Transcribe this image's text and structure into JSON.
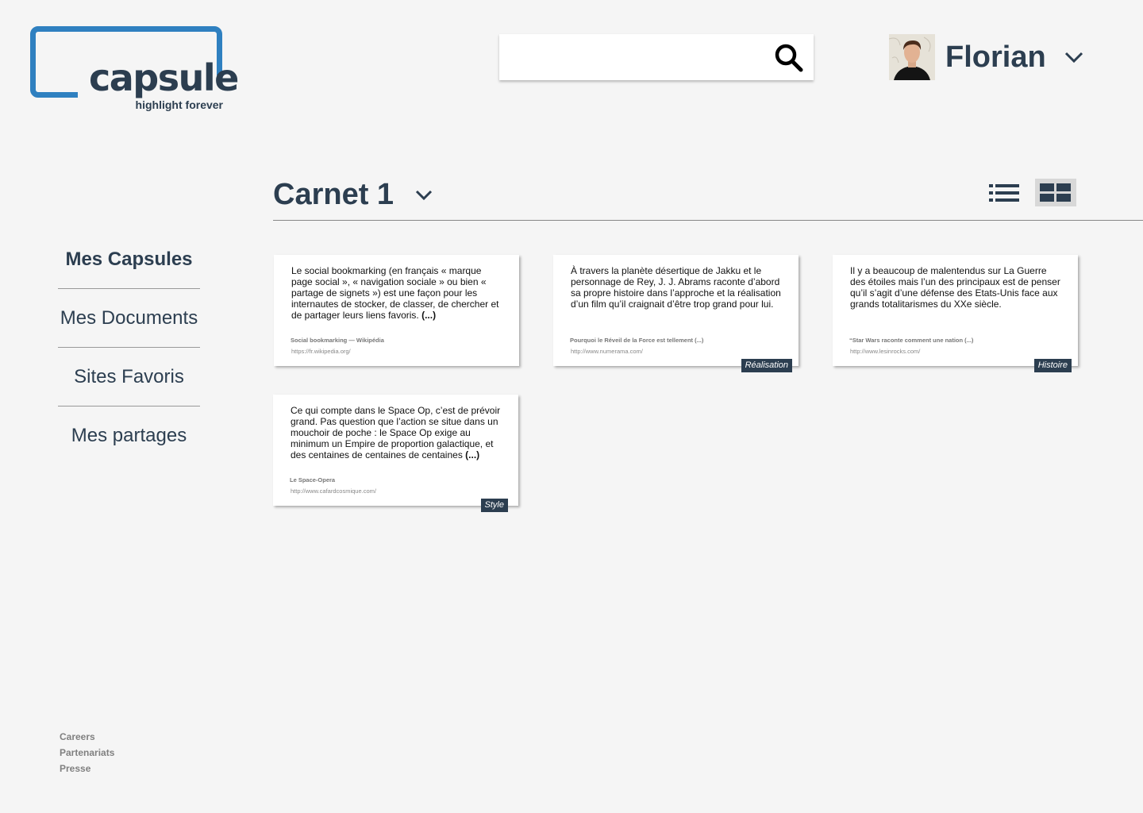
{
  "logo": {
    "word": "capsule",
    "tagline": "highlight forever"
  },
  "search": {
    "value": "",
    "placeholder": "",
    "icon": "search-icon"
  },
  "user": {
    "name": "Florian",
    "avatar_icon": "user-avatar",
    "menu_icon": "chevron-down-icon"
  },
  "sidebar": {
    "items": [
      {
        "label": "Mes Capsules",
        "active": true
      },
      {
        "label": "Mes Documents",
        "active": false
      },
      {
        "label": "Sites Favoris",
        "active": false
      },
      {
        "label": "Mes partages",
        "active": false
      }
    ]
  },
  "footer": {
    "links": [
      "Careers",
      "Partenariats",
      "Presse"
    ]
  },
  "notebook": {
    "title": "Carnet 1",
    "menu_icon": "chevron-down-icon"
  },
  "view_toggle": {
    "list_icon": "list-view-icon",
    "grid_icon": "grid-view-icon",
    "selected": "grid"
  },
  "capsules": [
    {
      "text": "Le social bookmarking (en français « marque page social », « navigation sociale » ou bien « partage de signets ») est une façon pour les internautes de stocker, de classer, de chercher et de partager leurs liens favoris.",
      "more": "(...)",
      "source": "Social bookmarking — Wikipédia",
      "url": "https://fr.wikipedia.org/",
      "tag": ""
    },
    {
      "text": "À travers la planète désertique de Jakku et le personnage de Rey, J. J. Abrams raconte d’abord sa propre histoire dans l’approche et la réalisation d’un film qu’il craignait d’être trop grand pour lui.",
      "more": "",
      "source": "Pourquoi le Réveil de la Force est tellement (...)",
      "url": "http://www.numerama.com/",
      "tag": "Réalisation"
    },
    {
      "text": "Il y a beaucoup de malentendus sur La Guerre des étoiles mais l’un des principaux est de penser qu’il s’agit d’une défense des Etats-Unis face aux grands totalitarismes du XXe siècle.",
      "more": "",
      "source": "“Star Wars raconte comment une nation (...)",
      "url": "http://www.lesinrocks.com/",
      "tag": "Histoire"
    },
    {
      "text": "Ce qui compte dans le Space Op, c’est de prévoir grand. Pas question que l’action se situe dans un mouchoir de poche : le Space Op exige au minimum un Empire de proportion galactique, et des centaines de centaines de centaines",
      "more": "(...)",
      "source": "Le Space-Opera",
      "url": "http://www.cafardcosmique.com/",
      "tag": "Style"
    }
  ]
}
